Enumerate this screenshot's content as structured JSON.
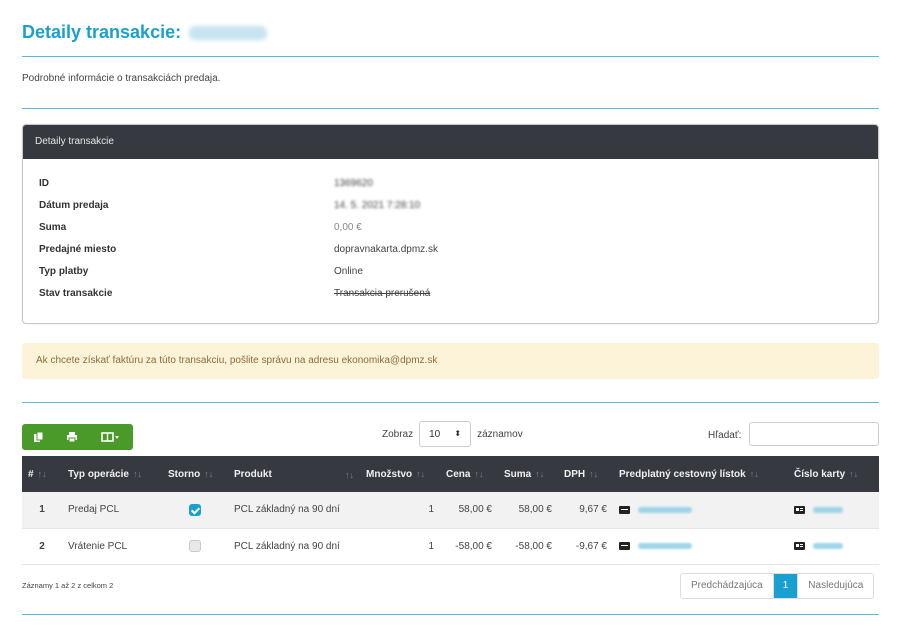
{
  "header": {
    "title": "Detaily transakcie:",
    "subtitle": "Podrobné informácie o transakciách predaja."
  },
  "panel": {
    "title": "Detaily transakcie",
    "rows": [
      {
        "label": "ID",
        "value": "1369620"
      },
      {
        "label": "Dátum predaja",
        "value": "14. 5. 2021 7:28:10"
      },
      {
        "label": "Suma",
        "value": "0,00 €"
      },
      {
        "label": "Predajné miesto",
        "value": "dopravnakarta.dpmz.sk"
      },
      {
        "label": "Typ platby",
        "value": "Online"
      },
      {
        "label": "Stav transakcie",
        "value": "Transakcia prerušená"
      }
    ]
  },
  "alert": {
    "text": "Ak chcete získať faktúru za túto transakciu, pošlite správu na adresu ekonomika@dpmz.sk"
  },
  "toolbar": {
    "length_prefix": "Zobraz",
    "length_value": "10",
    "length_suffix": "záznamov",
    "search_label": "Hľadať:",
    "search_value": ""
  },
  "table": {
    "headers": [
      "#",
      "Typ operácie",
      "Storno",
      "Produkt",
      "Množstvo",
      "Cena",
      "Suma",
      "DPH",
      "Predplatný cestovný lístok",
      "Číslo karty"
    ],
    "rows": [
      {
        "num": "1",
        "type": "Predaj PCL",
        "storno": true,
        "product": "PCL základný na 90 dní",
        "qty": "1",
        "price": "58,00 €",
        "sum": "58,00 €",
        "vat": "9,67 €"
      },
      {
        "num": "2",
        "type": "Vrátenie PCL",
        "storno": false,
        "product": "PCL základný na 90 dní",
        "qty": "1",
        "price": "-58,00 €",
        "sum": "-58,00 €",
        "vat": "-9,67 €"
      }
    ]
  },
  "footer": {
    "info": "Záznamy 1 až 2 z celkom 2",
    "prev": "Predchádzajúca",
    "page": "1",
    "next": "Nasledujúca"
  },
  "colors": {
    "accent": "#1a9fd1",
    "header_dark": "#363a40",
    "button_green": "#4a9a2a",
    "alert_bg": "#fcf3d9",
    "positive": "#4aa832",
    "negative": "#d9534f"
  },
  "icons": [
    "copy-icon",
    "print-icon",
    "columns-icon",
    "ticket-icon",
    "card-icon"
  ]
}
